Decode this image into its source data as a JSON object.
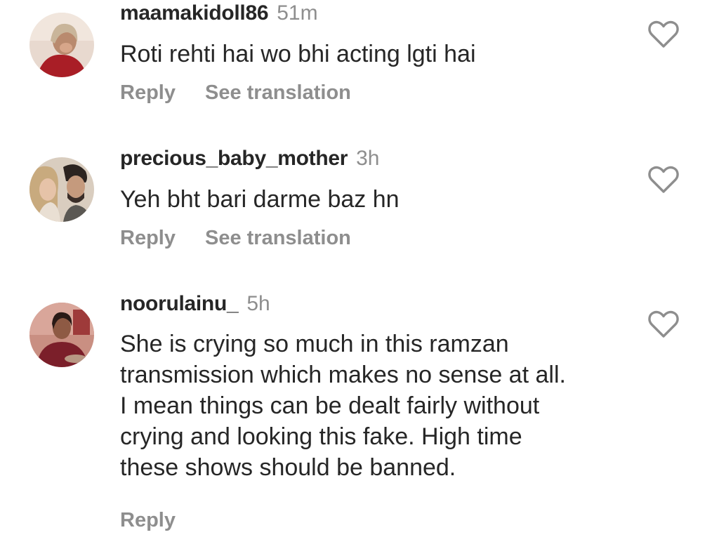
{
  "comments": [
    {
      "username": "maamakidoll86",
      "time": "51m",
      "text": "Roti rehti hai wo bhi acting lgti hai",
      "reply_label": "Reply",
      "translate_label": "See translation"
    },
    {
      "username": "precious_baby_mother",
      "time": "3h",
      "text": "Yeh bht bari darme baz hn",
      "reply_label": "Reply",
      "translate_label": "See translation"
    },
    {
      "username": "noorulainu_",
      "time": "5h",
      "text_lines": [
        "She is crying so much in this ramzan",
        "transmission which makes no sense at all.",
        "I mean things can be dealt fairly without",
        "crying and looking this fake. High time",
        "these shows should be banned."
      ],
      "reply_label": "Reply"
    }
  ],
  "colors": {
    "text": "#262626",
    "secondary": "#8e8e8e",
    "heart_outline": "#8e8e8e"
  },
  "icons": {
    "like": "heart-outline-icon"
  }
}
